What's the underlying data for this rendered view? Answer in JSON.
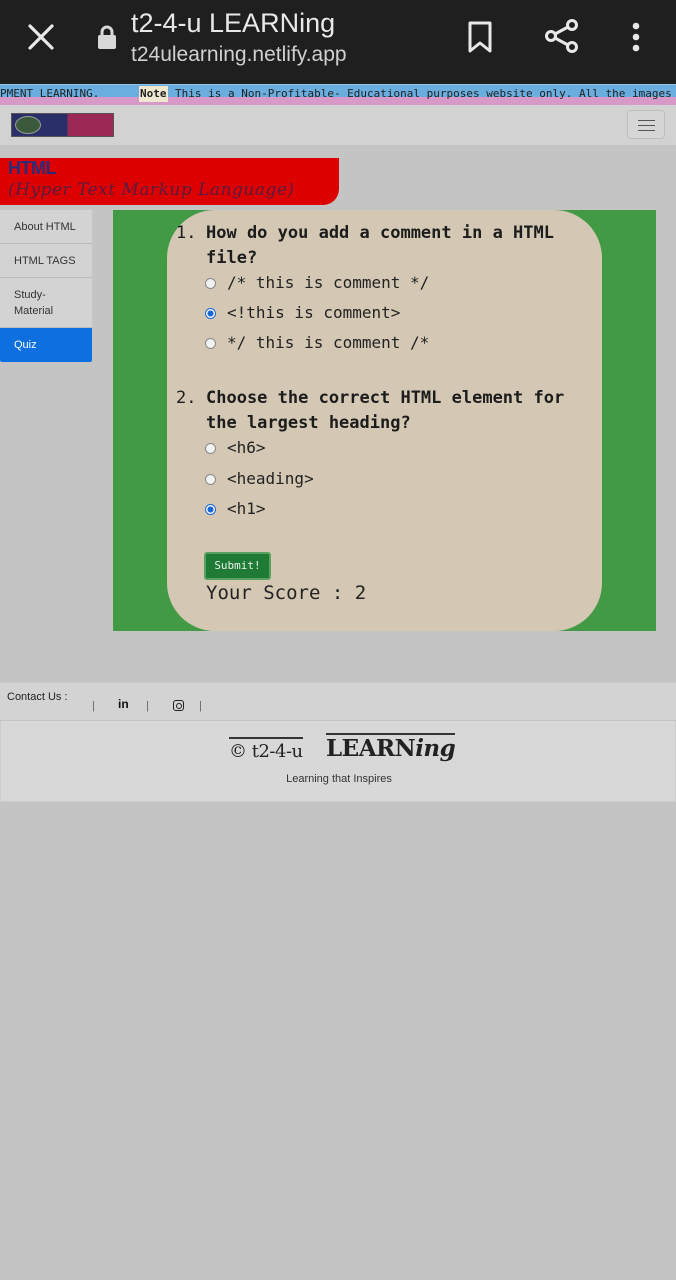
{
  "browser": {
    "title": "t2-4-u LEARNing",
    "url": "t24ulearning.netlify.app",
    "icons": [
      "close-icon",
      "lock-icon",
      "bookmark-icon",
      "share-icon",
      "more-vert-icon"
    ]
  },
  "marquee": {
    "lead_text": "PMENT LEARNING.",
    "note_tag": "Note",
    "note_text": "This is a Non-Profitable- Educational purposes website only. All the images"
  },
  "navbar": {
    "logo_alt": "t2-4-u LEARNing logo",
    "menu_icon": "hamburger-icon"
  },
  "header": {
    "title": "HTML",
    "subtitle": "(Hyper Text Markup Language)"
  },
  "side_menu": {
    "items": [
      {
        "label": "About HTML",
        "active": false
      },
      {
        "label": "HTML TAGS",
        "active": false
      },
      {
        "label": "Study-Material",
        "line1": "Study-",
        "line2": "Material",
        "active": false
      },
      {
        "label": "Quiz",
        "active": true
      }
    ]
  },
  "quiz": {
    "questions": [
      {
        "number": "1.",
        "text": "How do you add a comment in a HTML file?",
        "options": [
          {
            "label": "/* this is comment */",
            "checked": false
          },
          {
            "label": "<!this is comment>",
            "checked": true
          },
          {
            "label": "*/ this is comment /*",
            "checked": false
          }
        ]
      },
      {
        "number": "2.",
        "text": "Choose the correct HTML element for the largest heading?",
        "options": [
          {
            "label": "<h6>",
            "checked": false
          },
          {
            "label": "<heading>",
            "checked": false
          },
          {
            "label": "<h1>",
            "checked": true
          }
        ]
      }
    ],
    "submit_label": "Submit!",
    "score_text": "Your Score : 2",
    "colors": {
      "panel_green": "#439a45",
      "card": "#d4c8b5",
      "submit": "#1e7a34"
    }
  },
  "footer": {
    "contact_label": "Contact Us :",
    "separator": "|",
    "linkedin_label": "in",
    "brand_copy": "© t2-4-u",
    "brand_learn": "LEARN",
    "brand_ing": "ing",
    "tagline": "Learning that Inspires"
  },
  "colors": {
    "header_red": "#dc0000",
    "active_menu_blue": "#0d6fe0",
    "page_bg": "#c4c4c4"
  }
}
